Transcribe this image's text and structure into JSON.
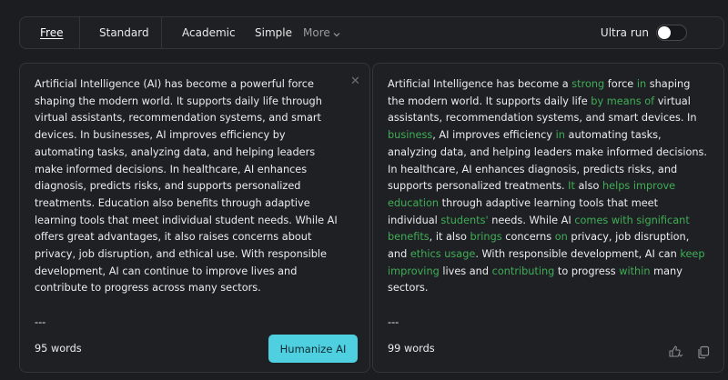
{
  "topbar": {
    "modes": [
      {
        "label": "Free",
        "active": true
      },
      {
        "label": "Standard",
        "active": false
      },
      {
        "label": "Academic",
        "active": false
      },
      {
        "label": "Simple",
        "active": false
      }
    ],
    "more_label": "More",
    "ultra_run_label": "Ultra run",
    "ultra_run_enabled": false
  },
  "input_panel": {
    "paragraph": "Artificial Intelligence (AI) has become a powerful force shaping the modern world. It supports daily life through virtual assistants, recommendation systems, and smart devices. In businesses, AI improves efficiency by automating tasks, analyzing data, and helping leaders make informed decisions. In healthcare, AI enhances diagnosis, predicts risks, and supports personalized treatments. Education also benefits through adaptive learning tools that meet individual student needs. While AI offers great advantages, it also raises concerns about privacy, job disruption, and ethical use. With responsible development, AI can continue to improve lives and contribute to progress across many sectors.",
    "separator": "---",
    "word_count": "95 words",
    "humanize_button": "Humanize AI"
  },
  "output_panel": {
    "segments": [
      {
        "text": "Artificial Intelligence has become a ",
        "changed": false
      },
      {
        "text": "strong",
        "changed": true
      },
      {
        "text": " force ",
        "changed": false
      },
      {
        "text": "in",
        "changed": true
      },
      {
        "text": " shaping the modern world. It supports daily life ",
        "changed": false
      },
      {
        "text": "by means of",
        "changed": true
      },
      {
        "text": " virtual assistants, recommendation systems, and smart devices. In ",
        "changed": false
      },
      {
        "text": "business",
        "changed": true
      },
      {
        "text": ", AI improves efficiency ",
        "changed": false
      },
      {
        "text": "in",
        "changed": true
      },
      {
        "text": " automating tasks, analyzing data, and helping leaders make informed decisions. In healthcare, AI enhances diagnosis, predicts risks, and supports personalized treatments. ",
        "changed": false
      },
      {
        "text": "It",
        "changed": true
      },
      {
        "text": " also ",
        "changed": false
      },
      {
        "text": "helps improve education",
        "changed": true
      },
      {
        "text": " through adaptive learning tools that meet individual ",
        "changed": false
      },
      {
        "text": "students'",
        "changed": true
      },
      {
        "text": " needs. While AI ",
        "changed": false
      },
      {
        "text": "comes with significant benefits",
        "changed": true
      },
      {
        "text": ", it also ",
        "changed": false
      },
      {
        "text": "brings",
        "changed": true
      },
      {
        "text": " concerns ",
        "changed": false
      },
      {
        "text": "on",
        "changed": true
      },
      {
        "text": " privacy, job disruption, and ",
        "changed": false
      },
      {
        "text": "ethics usage",
        "changed": true
      },
      {
        "text": ". With responsible development, AI can ",
        "changed": false
      },
      {
        "text": "keep improving",
        "changed": true
      },
      {
        "text": " lives and ",
        "changed": false
      },
      {
        "text": "contributing",
        "changed": true
      },
      {
        "text": " to progress ",
        "changed": false
      },
      {
        "text": "within",
        "changed": true
      },
      {
        "text": " many sectors.",
        "changed": false
      }
    ],
    "separator": "---",
    "word_count": "99 words"
  },
  "icons": {
    "close": "close-icon",
    "feedback": "thumbs-feedback-icon",
    "copy": "copy-icon",
    "more_chevron": "chevron-down-icon"
  },
  "colors": {
    "background": "#1c1d20",
    "panel": "#1f2024",
    "accent_button": "#4fd0e0",
    "changed_text": "#3fae56"
  }
}
